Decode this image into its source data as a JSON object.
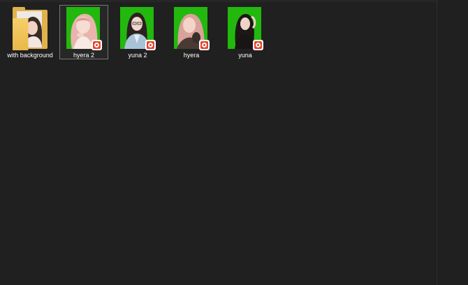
{
  "files": [
    {
      "name": "with background",
      "type": "folder",
      "selected": false
    },
    {
      "name": "hyera 2",
      "type": "image",
      "selected": true,
      "badge_icon": "app-badge-icon"
    },
    {
      "name": "yuna 2",
      "type": "image",
      "selected": false,
      "badge_icon": "app-badge-icon"
    },
    {
      "name": "hyera",
      "type": "image",
      "selected": false,
      "badge_icon": "app-badge-icon"
    },
    {
      "name": "yuna",
      "type": "image",
      "selected": false,
      "badge_icon": "app-badge-icon"
    }
  ],
  "colors": {
    "background": "#202020",
    "thumbnail_green": "#22b80e",
    "badge_red": "#e8452c",
    "folder_yellow": "#e0b24c",
    "label_text": "#ffffff"
  }
}
